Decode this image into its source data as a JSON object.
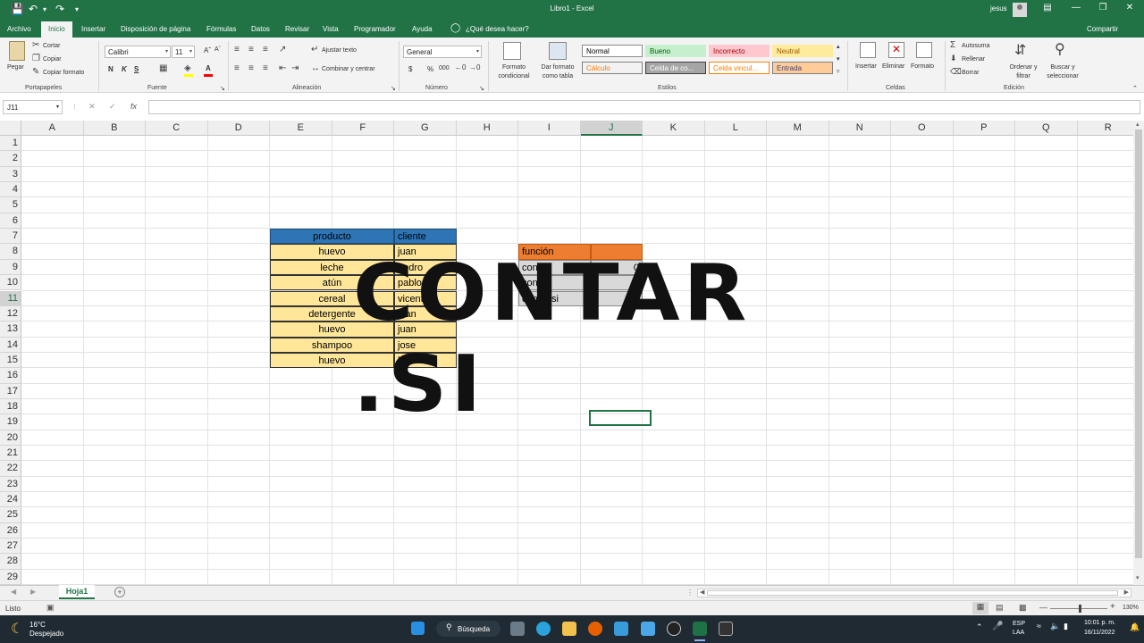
{
  "titlebar": {
    "title": "Libro1  -  Excel",
    "user": "jesus"
  },
  "tabs": [
    "Archivo",
    "Inicio",
    "Insertar",
    "Disposición de página",
    "Fórmulas",
    "Datos",
    "Revisar",
    "Vista",
    "Programador",
    "Ayuda"
  ],
  "tell_me": "¿Qué desea hacer?",
  "share": "Compartir",
  "ribbon": {
    "clipboard": {
      "paste": "Pegar",
      "cut": "Cortar",
      "copy": "Copiar",
      "format_painter": "Copiar formato",
      "label": "Portapapeles"
    },
    "font": {
      "name": "Calibri",
      "size": "11",
      "bold": "N",
      "italic": "K",
      "underline": "S",
      "label": "Fuente"
    },
    "alignment": {
      "wrap": "Ajustar texto",
      "merge": "Combinar y centrar",
      "label": "Alineación"
    },
    "number": {
      "format": "General",
      "currency": "$",
      "percent": "%",
      "thousands": "000",
      "label": "Número"
    },
    "styles": {
      "conditional": "Formato condicional",
      "as_table": "Dar formato como tabla",
      "cells": [
        {
          "text": "Normal",
          "bg": "#ffffff",
          "fg": "#000000",
          "border": "#8a8a8a"
        },
        {
          "text": "Bueno",
          "bg": "#c6efce",
          "fg": "#006100",
          "border": "#c6efce"
        },
        {
          "text": "Incorrecto",
          "bg": "#ffc7ce",
          "fg": "#9c0006",
          "border": "#ffc7ce"
        },
        {
          "text": "Neutral",
          "bg": "#ffeb9c",
          "fg": "#9c5700",
          "border": "#ffeb9c"
        },
        {
          "text": "Cálculo",
          "bg": "#f2f2f2",
          "fg": "#fa7d00",
          "border": "#7f7f7f"
        },
        {
          "text": "Celda de co...",
          "bg": "#a5a5a5",
          "fg": "#ffffff",
          "border": "#3f3f3f"
        },
        {
          "text": "Celda vincul...",
          "bg": "#ffffff",
          "fg": "#fa7d00",
          "border": "#ff8001"
        },
        {
          "text": "Entrada",
          "bg": "#ffcc99",
          "fg": "#3f3f76",
          "border": "#7f7f7f"
        }
      ],
      "label": "Estilos"
    },
    "cells": {
      "insert": "Insertar",
      "delete": "Eliminar",
      "format": "Formato",
      "label": "Celdas"
    },
    "editing": {
      "autosum": "Autosuma",
      "fill": "Rellenar",
      "clear": "Borrar",
      "sort": "Ordenar y filtrar",
      "find": "Buscar y seleccionar",
      "label": "Edición"
    }
  },
  "formula_bar": {
    "name_box": "J11",
    "cancel": "✕",
    "enter": "✓",
    "fx": "fx",
    "value": ""
  },
  "grid": {
    "columns": [
      "A",
      "B",
      "C",
      "D",
      "E",
      "F",
      "G",
      "H",
      "I",
      "J",
      "K",
      "L",
      "M",
      "N",
      "O",
      "P",
      "Q",
      "R"
    ],
    "rows": [
      "1",
      "2",
      "3",
      "4",
      "5",
      "6",
      "7",
      "8",
      "9",
      "10",
      "11",
      "12",
      "13",
      "14",
      "15",
      "16",
      "17",
      "18",
      "19",
      "20",
      "21",
      "22",
      "23",
      "24",
      "25",
      "26",
      "27",
      "28",
      "29"
    ],
    "selected_col": "J",
    "selected_row": "11"
  },
  "table": {
    "headers": [
      "producto",
      "cliente"
    ],
    "header_bg": "#2e75b6",
    "row_bg": "#ffe699",
    "rows": [
      [
        "huevo",
        "juan"
      ],
      [
        "leche",
        "pedro"
      ],
      [
        "atún",
        "pablo"
      ],
      [
        "cereal",
        "vicente"
      ],
      [
        "detergente",
        "juan"
      ],
      [
        "huevo",
        "juan"
      ],
      [
        "shampoo",
        "jose"
      ],
      [
        "huevo",
        "luis"
      ]
    ]
  },
  "func_table": {
    "header": "función",
    "header_bg": "#ed7d31",
    "rows": [
      {
        "label": "contar",
        "value": "0"
      },
      {
        "label": "contar",
        "value": ""
      },
      {
        "label": "contar.si",
        "value": ""
      }
    ]
  },
  "overlay_text": "CONTAR .SI",
  "sheet": {
    "name": "Hoja1"
  },
  "status": {
    "ready": "Listo",
    "zoom": "130%"
  },
  "taskbar": {
    "temp": "16°C",
    "weather": "Despejado",
    "search": "Búsqueda",
    "lang1": "ESP",
    "lang2": "LAA",
    "time": "10:01 p. m.",
    "date": "16/11/2022"
  }
}
